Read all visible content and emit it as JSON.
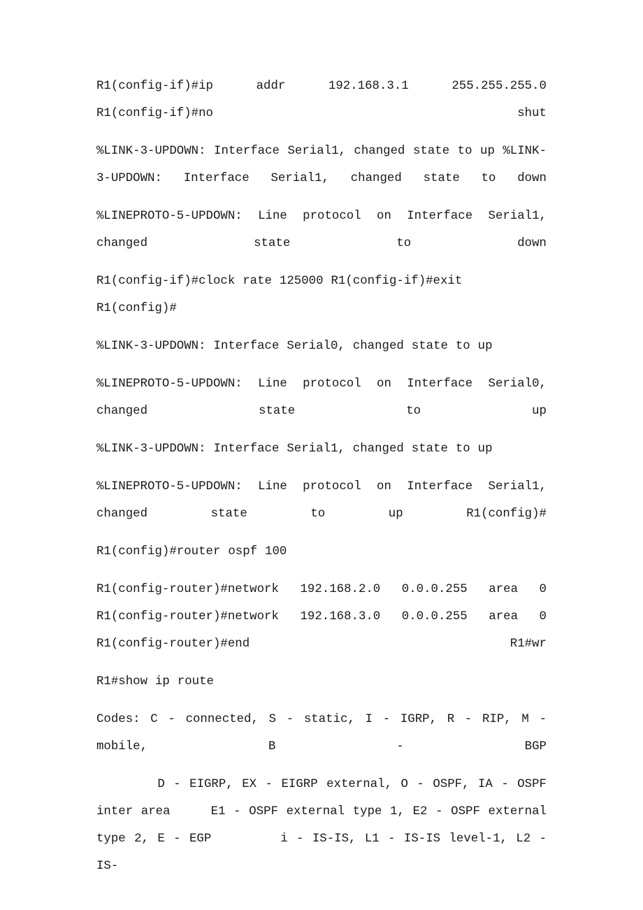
{
  "document": {
    "title": "Cisco router CLI transcript",
    "page_background": "#ffffff",
    "text_color": "#1a1a1a",
    "paragraphs": [
      {
        "id": "p1",
        "text": "R1(config-if)#ip  addr  192.168.3.1  255.255.255.0  R1(config-if)#no shut",
        "align": "justify"
      },
      {
        "id": "p2",
        "text": "%LINK-3-UPDOWN: Interface Serial1, changed state to up %LINK-3-UPDOWN: Interface Serial1, changed state to down",
        "align": "justify"
      },
      {
        "id": "p3",
        "text": "%LINEPROTO-5-UPDOWN:  Line  protocol  on  Interface  Serial1, changed state to down",
        "align": "justify"
      },
      {
        "id": "p4",
        "text": "R1(config-if)#clock rate 125000 R1(config-if)#exit R1(config)#",
        "align": "left"
      },
      {
        "id": "p5",
        "text": "%LINK-3-UPDOWN: Interface Serial0, changed state to up",
        "align": "left"
      },
      {
        "id": "p6",
        "text": "%LINEPROTO-5-UPDOWN:  Line  protocol  on  Interface  Serial0, changed state to up",
        "align": "justify"
      },
      {
        "id": "p7",
        "text": "%LINK-3-UPDOWN: Interface Serial1, changed state to up",
        "align": "left"
      },
      {
        "id": "p8",
        "text": "%LINEPROTO-5-UPDOWN:  Line  protocol  on  Interface  Serial1, changed state to up R1(config)#",
        "align": "justify"
      },
      {
        "id": "p9",
        "text": "R1(config)#router ospf 100",
        "align": "left"
      },
      {
        "id": "p10",
        "text": "R1(config-router)#network  192.168.2.0  0.0.0.255  area  0 R1(config-router)#network  192.168.3.0  0.0.0.255  area  0 R1(config-router)#end  R1#wr",
        "align": "justify"
      },
      {
        "id": "p11",
        "text": "R1#show ip route",
        "align": "left"
      },
      {
        "id": "p12",
        "text": "Codes: C - connected, S - static, I - IGRP, R - RIP, M - mobile, B - BGP",
        "align": "justify"
      },
      {
        "id": "p13",
        "text": "       D - EIGRP, EX - EIGRP external, O - OSPF, IA - OSPF inter area     E1 - OSPF external type 1, E2 - OSPF external type 2, E - EGP        i - IS-IS, L1 - IS-IS level-1, L2 - IS-",
        "align": "justify"
      }
    ]
  }
}
